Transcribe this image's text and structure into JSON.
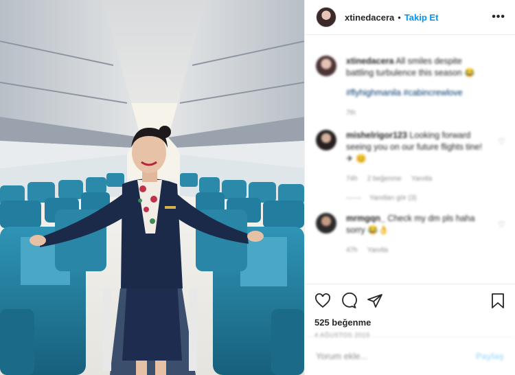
{
  "header": {
    "username": "xtinedacera",
    "separator": "•",
    "follow_label": "Takip Et",
    "more_label": "•••"
  },
  "caption": {
    "username": "xtinedacera",
    "text": "All smiles despite battling turbulence this season 😂",
    "hashtags": "#flyhighmanila #cabincrewlove",
    "time": "7th"
  },
  "comments": [
    {
      "username": "mishelrigor123",
      "text": "Looking forward seeing you on our future flights tine! ✈ 😊",
      "time": "74h",
      "likes": "2 beğenme",
      "reply": "Yanıtla"
    },
    {
      "username": "mrmgqn_",
      "text": "Check my dm pls haha sorry 😂👌",
      "time": "47h",
      "reply": "Yanıtla"
    }
  ],
  "view_replies": "Yanıtları gör (3)",
  "likes": "525 beğenme",
  "date": "4 AĞUSTOS 2019",
  "add_comment": {
    "placeholder": "Yorum ekle...",
    "post_label": "Paylaş"
  },
  "colors": {
    "accent": "#0095f6",
    "seat": "#1f7a9a",
    "uniform": "#1c2a4a"
  }
}
